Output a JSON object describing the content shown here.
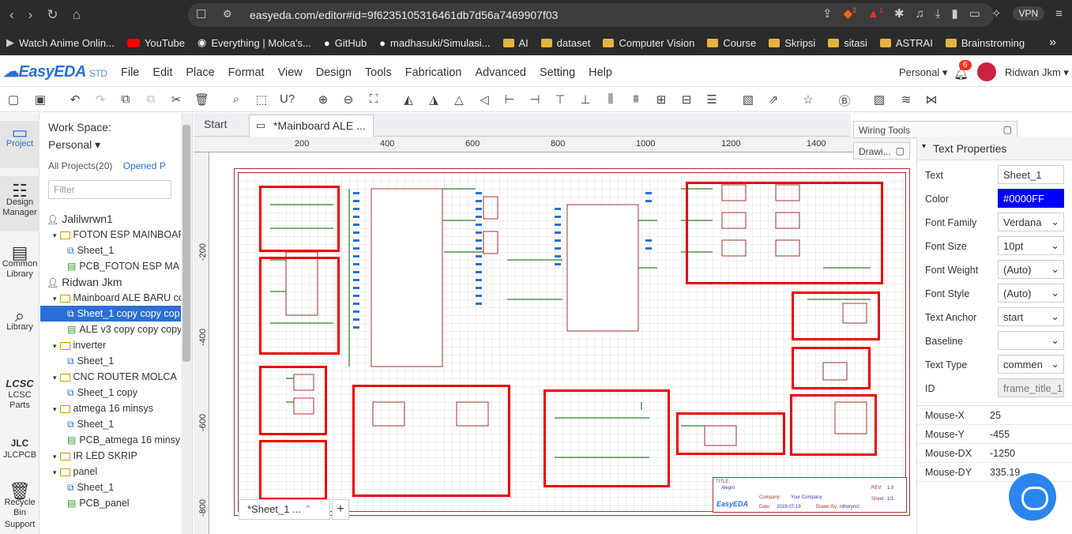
{
  "browser": {
    "url": "easyeda.com/editor#id=9f6235105316461db7d56a7469907f03",
    "vpn_label": "VPN",
    "brave_count": "2",
    "alert_count": "1",
    "bookmarks": [
      "Watch Anime Onlin...",
      "YouTube",
      "Everything | Molca's...",
      "GitHub",
      "madhasuki/Simulasi...",
      "AI",
      "dataset",
      "Computer Vision",
      "Course",
      "Skripsi",
      "sitasi",
      "ASTRAI",
      "Brainstroming"
    ]
  },
  "app": {
    "logo": "EasyEDA",
    "logo_suffix": "STD",
    "menu": [
      "File",
      "Edit",
      "Place",
      "Format",
      "View",
      "Design",
      "Tools",
      "Fabrication",
      "Advanced",
      "Setting",
      "Help"
    ],
    "workspace_mode": "Personal",
    "notification_count": "6",
    "user_name": "Ridwan Jkm"
  },
  "rail": [
    {
      "label": "Project",
      "icon": "folder-icon"
    },
    {
      "label": "Design Manager",
      "icon": "design-manager-icon"
    },
    {
      "label": "Common Library",
      "icon": "common-library-icon"
    },
    {
      "label": "Library",
      "icon": "library-icon"
    },
    {
      "label": "LCSC Parts",
      "icon": "lcsc-icon"
    },
    {
      "label": "JLCPCB",
      "icon": "jlcpcb-icon"
    },
    {
      "label": "Recycle Bin",
      "icon": "recycle-bin-icon"
    },
    {
      "label": "Support",
      "icon": "support-icon"
    }
  ],
  "project_panel": {
    "workspace_label": "Work Space:",
    "workspace_value": "Personal",
    "all_projects": "All Projects(20)",
    "opened": "Opened P",
    "filter_placeholder": "Filter",
    "tree": [
      {
        "level": 0,
        "text": "Jalilwrwn1",
        "type": "user"
      },
      {
        "level": 1,
        "text": "FOTON ESP MAINBOAR",
        "type": "folder"
      },
      {
        "level": 2,
        "text": "Sheet_1",
        "type": "sch"
      },
      {
        "level": 2,
        "text": "PCB_FOTON ESP MA",
        "type": "pcb"
      },
      {
        "level": 0,
        "text": "Ridwan Jkm",
        "type": "user"
      },
      {
        "level": 1,
        "text": "Mainboard ALE BARU co",
        "type": "folder"
      },
      {
        "level": 2,
        "text": "Sheet_1 copy copy cop",
        "type": "sch",
        "selected": true
      },
      {
        "level": 2,
        "text": "ALE v3 copy copy copy",
        "type": "pcb"
      },
      {
        "level": 1,
        "text": "inverter",
        "type": "folder"
      },
      {
        "level": 2,
        "text": "Sheet_1",
        "type": "sch"
      },
      {
        "level": 1,
        "text": "CNC ROUTER MOLCA",
        "type": "folder"
      },
      {
        "level": 2,
        "text": "Sheet_1 copy",
        "type": "sch"
      },
      {
        "level": 1,
        "text": "atmega 16 minsys",
        "type": "folder"
      },
      {
        "level": 2,
        "text": "Sheet_1",
        "type": "sch"
      },
      {
        "level": 2,
        "text": "PCB_atmega 16 minsy",
        "type": "pcb"
      },
      {
        "level": 1,
        "text": "IR LED SKRIP",
        "type": "folder"
      },
      {
        "level": 1,
        "text": "panel",
        "type": "folder"
      },
      {
        "level": 2,
        "text": "Sheet_1",
        "type": "sch"
      },
      {
        "level": 2,
        "text": "PCB_panel",
        "type": "pcb"
      }
    ]
  },
  "doc_tabs": {
    "start": "Start",
    "active": "*Mainboard ALE ..."
  },
  "ruler": {
    "h": [
      "200",
      "400",
      "600",
      "800",
      "1000",
      "1200",
      "1400"
    ],
    "v": [
      "-200",
      "-400",
      "-600",
      "-800"
    ]
  },
  "sheet_tab": "*Sheet_1 ...",
  "floating": {
    "wiring": "Wiring Tools",
    "drawing": "Drawi..."
  },
  "title_block": {
    "title_label": "TITLE:",
    "title": "Alegro",
    "rev_label": "REV:",
    "rev": "1.0",
    "company_label": "Company:",
    "company": "Your Company",
    "sheet_label": "Sheet:",
    "sheet": "1/1",
    "date_label": "Date:",
    "date": "2019-07-19",
    "drawn_label": "Drawn By:",
    "drawn": "rdhoryncl",
    "brand": "EasyEDA"
  },
  "text_properties": {
    "header": "Text Properties",
    "rows": [
      {
        "label": "Text",
        "value": "Sheet_1"
      },
      {
        "label": "Color",
        "value": "#0000FF"
      },
      {
        "label": "Font Family",
        "value": "Verdana"
      },
      {
        "label": "Font Size",
        "value": "10pt"
      },
      {
        "label": "Font Weight",
        "value": "(Auto)"
      },
      {
        "label": "Font Style",
        "value": "(Auto)"
      },
      {
        "label": "Text Anchor",
        "value": "start"
      },
      {
        "label": "Baseline",
        "value": ""
      },
      {
        "label": "Text Type",
        "value": "commen"
      },
      {
        "label": "ID",
        "value": "frame_title_1"
      }
    ]
  },
  "mouse": [
    {
      "label": "Mouse-X",
      "value": "25"
    },
    {
      "label": "Mouse-Y",
      "value": "-455"
    },
    {
      "label": "Mouse-DX",
      "value": "-1250"
    },
    {
      "label": "Mouse-DY",
      "value": "335.19"
    }
  ],
  "colors": {
    "accent": "#2a6fd6",
    "highlight": "#e00000",
    "text_color_prop": "#0000FF"
  }
}
